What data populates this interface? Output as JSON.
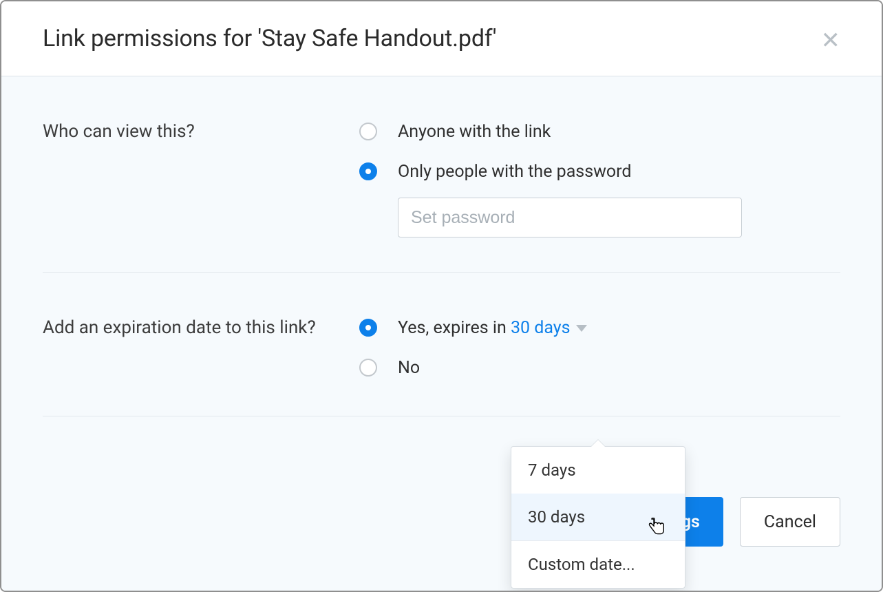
{
  "dialog": {
    "title": "Link permissions for 'Stay Safe Handout.pdf'"
  },
  "view": {
    "question": "Who can view this?",
    "options": {
      "anyone": {
        "label": "Anyone with the link",
        "checked": false
      },
      "password": {
        "label": "Only people with the password",
        "checked": true
      }
    },
    "password_placeholder": "Set password"
  },
  "expire": {
    "question": "Add an expiration date to this link?",
    "yes": {
      "prefix": "Yes, expires in ",
      "value": "30 days",
      "checked": true
    },
    "no": {
      "label": "No",
      "checked": false
    },
    "dropdown": {
      "opt_7": "7 days",
      "opt_30": "30 days",
      "opt_custom": "Custom date..."
    }
  },
  "footer": {
    "save": "Save settings",
    "cancel": "Cancel"
  }
}
